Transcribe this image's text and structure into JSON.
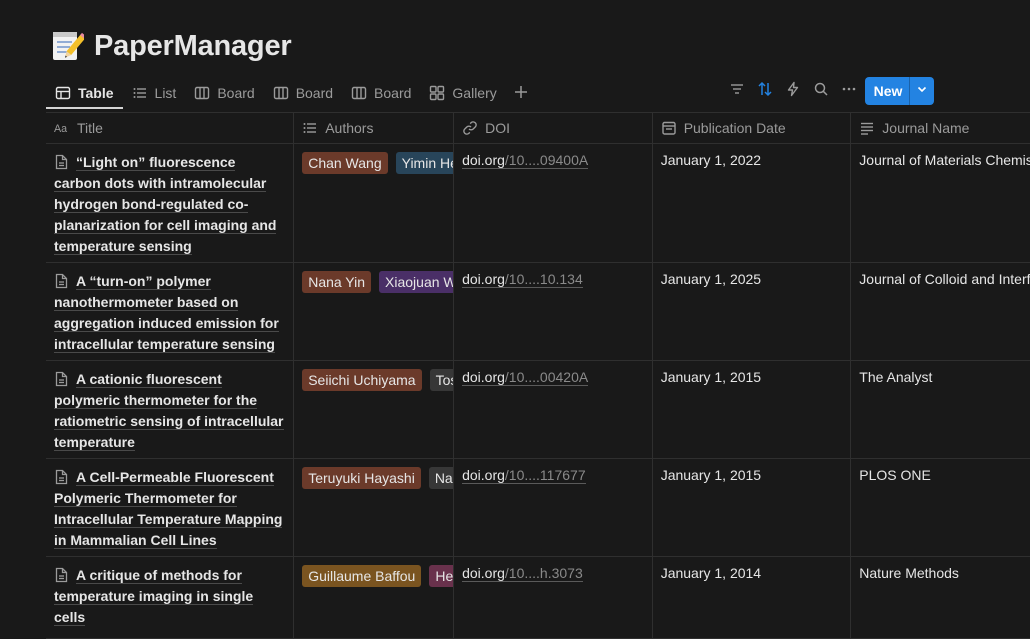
{
  "page": {
    "title": "PaperManager",
    "icon": "memo-icon"
  },
  "views": [
    {
      "label": "Table",
      "icon": "table-icon",
      "active": true
    },
    {
      "label": "List",
      "icon": "list-icon"
    },
    {
      "label": "Board",
      "icon": "board-icon"
    },
    {
      "label": "Board",
      "icon": "board-icon"
    },
    {
      "label": "Board",
      "icon": "board-icon"
    },
    {
      "label": "Gallery",
      "icon": "gallery-icon"
    }
  ],
  "toolbar": {
    "new_label": "New",
    "accent": "#2383e2",
    "sort_active_color": "#2383e2"
  },
  "columns": [
    {
      "label": "Title",
      "icon": "text-type-icon"
    },
    {
      "label": "Authors",
      "icon": "multiselect-icon"
    },
    {
      "label": "DOI",
      "icon": "link-icon"
    },
    {
      "label": "Publication Date",
      "icon": "calendar-icon"
    },
    {
      "label": "Journal Name",
      "icon": "text-lines-icon"
    }
  ],
  "rows": [
    {
      "title": "“Light on” fluorescence carbon dots with intramolecular hydrogen bond-regulated co-planarization for cell imaging and temperature sensing",
      "authors": [
        {
          "name": "Chan Wang",
          "color": "#6b3a2a"
        },
        {
          "name": "Yimin He",
          "color": "#28455a"
        }
      ],
      "doi_host": "doi.org",
      "doi_rest": "/10....09400A",
      "date": "January 1, 2022",
      "journal": "Journal of Materials Chemistry"
    },
    {
      "title": "A “turn-on” polymer nanothermometer based on aggregation induced emission for intracellular temperature sensing",
      "authors": [
        {
          "name": "Nana Yin",
          "color": "#6b3a2a"
        },
        {
          "name": "Xiaojuan Wang",
          "color": "#4a2f67"
        }
      ],
      "doi_host": "doi.org",
      "doi_rest": "/10....10.134",
      "date": "January 1, 2025",
      "journal": "Journal of Colloid and Interface Science"
    },
    {
      "title": "A cationic fluorescent polymeric thermometer for the ratiometric sensing of intracellular temperature",
      "authors": [
        {
          "name": "Seiichi Uchiyama",
          "color": "#6b3a2a"
        },
        {
          "name": "Toshikazu",
          "color": "#373737"
        }
      ],
      "doi_host": "doi.org",
      "doi_rest": "/10....00420A",
      "date": "January 1, 2015",
      "journal": "The Analyst"
    },
    {
      "title": "A Cell-Permeable Fluorescent Polymeric Thermometer for Intracellular Temperature Mapping in Mammalian Cell Lines",
      "authors": [
        {
          "name": "Teruyuki Hayashi",
          "color": "#6b3a2a"
        },
        {
          "name": "Nanaho",
          "color": "#373737"
        }
      ],
      "doi_host": "doi.org",
      "doi_rest": "/10....117677",
      "date": "January 1, 2015",
      "journal": "PLOS ONE"
    },
    {
      "title": "A critique of methods for temperature imaging in single cells",
      "authors": [
        {
          "name": "Guillaume Baffou",
          "color": "#7a5420"
        },
        {
          "name": "Hervé",
          "color": "#69314c"
        }
      ],
      "doi_host": "doi.org",
      "doi_rest": "/10....h.3073",
      "date": "January 1, 2014",
      "journal": "Nature Methods"
    }
  ]
}
